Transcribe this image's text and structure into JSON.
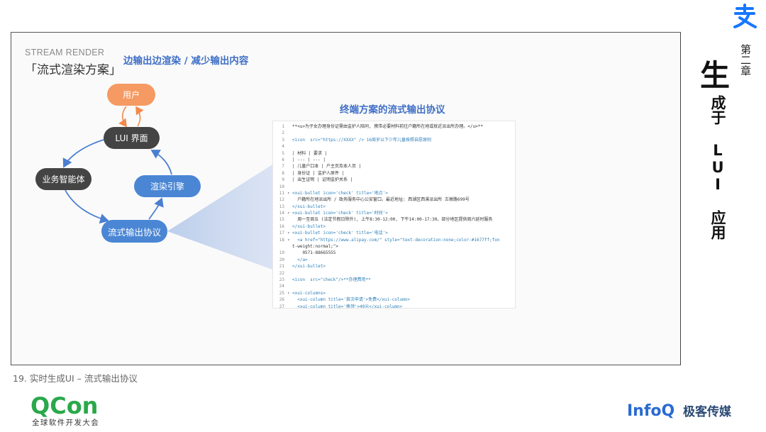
{
  "header": {
    "stream_label": "STREAM RENDER",
    "scheme_label": "「流式渲染方案」",
    "subtitle": "边输出边渲染 / 减少输出内容"
  },
  "diagram": {
    "user": "用户",
    "lui": "LUI 界面",
    "agent": "业务智能体",
    "render_engine": "渲染引擎",
    "protocol": "流式输出协议",
    "colors": {
      "user": "#f59a62",
      "dark": "#444444",
      "blue": "#4a86d4",
      "arrow": "#4a7fd0"
    }
  },
  "code_panel": {
    "title": "终端方案的流式输出协议",
    "lines": [
      {
        "n": "1",
        "f": "",
        "t": "**<u>为子女办理身份证需由监护人陪同, 携带必要材料前往户籍所在地或就近派出所办理。</u>**"
      },
      {
        "n": "2",
        "f": "",
        "t": ""
      },
      {
        "n": "3",
        "f": "",
        "t": "<icon  src=\"https://XXXX\" /> 16周岁以下少年儿童按照自愿原则"
      },
      {
        "n": "4",
        "f": "",
        "t": ""
      },
      {
        "n": "5",
        "f": "",
        "t": "| 材料 | 要求 |"
      },
      {
        "n": "6",
        "f": "",
        "t": "| --- | --- |"
      },
      {
        "n": "7",
        "f": "",
        "t": "| 儿童户口本 | 户主页及本人页 |"
      },
      {
        "n": "8",
        "f": "",
        "t": "| 身份证 | 监护人原件 |"
      },
      {
        "n": "9",
        "f": "",
        "t": "| 出生证明 | 证明监护关系 |"
      },
      {
        "n": "10",
        "f": "",
        "t": ""
      },
      {
        "n": "11",
        "f": "▾",
        "t": "<xui-bullet icon='check' title='地点'>"
      },
      {
        "n": "12",
        "f": "",
        "t": "  户籍所在地派出所 / 政务服务中心公安窗口。最近地址: 西湖区西溪派出所 古墩路699号"
      },
      {
        "n": "13",
        "f": "",
        "t": "</xui-bullet>"
      },
      {
        "n": "14",
        "f": "▾",
        "t": "<xui-bullet icon='check' title='时间'>"
      },
      {
        "n": "15",
        "f": "",
        "t": "  周一至周五 (法定节假日除外), 上午8:30-12:00, 下午14:00-17:30。部分地区提供周六延时服务"
      },
      {
        "n": "16",
        "f": "",
        "t": "</xui-bullet>"
      },
      {
        "n": "17",
        "f": "▾",
        "t": "<xui-bullet icon='check' title='电话'>"
      },
      {
        "n": "18",
        "f": "▾",
        "t": "  <a href=\"https://www.alipay.com/\" style=\"text-decoration:none;color:#1677ff;fon"
      },
      {
        "n": "",
        "f": "",
        "t": "t-weight:normal;\">"
      },
      {
        "n": "19",
        "f": "",
        "t": "    0571-88665555"
      },
      {
        "n": "20",
        "f": "",
        "t": "  </a>"
      },
      {
        "n": "21",
        "f": "",
        "t": "</xui-bullet>"
      },
      {
        "n": "22",
        "f": "",
        "t": ""
      },
      {
        "n": "23",
        "f": "",
        "t": "<icon  src=\"check\"/>**办理费用**"
      },
      {
        "n": "24",
        "f": "",
        "t": ""
      },
      {
        "n": "25",
        "f": "▾",
        "t": "<xui-columns>"
      },
      {
        "n": "26",
        "f": "",
        "t": "  <xui-column title='首次申请'>免费</xui-column>"
      },
      {
        "n": "27",
        "f": "",
        "t": "  <xui-column title='换领'>40元</xui-column>"
      }
    ]
  },
  "caption": "19. 实时生成UI – 流式输出协议",
  "chapter": {
    "label": "第二章",
    "title_first": "生",
    "title_rest": "成于 LUI 应用"
  },
  "footer": {
    "qcon_text": "QCon",
    "qcon_sub": "全球软件开发大会",
    "infoq_text": "InfoQ",
    "geek_name": "极客传媒"
  },
  "brand_colors": {
    "qcon_green": "#2aa84a",
    "infoq_blue": "#2a6bd1"
  }
}
